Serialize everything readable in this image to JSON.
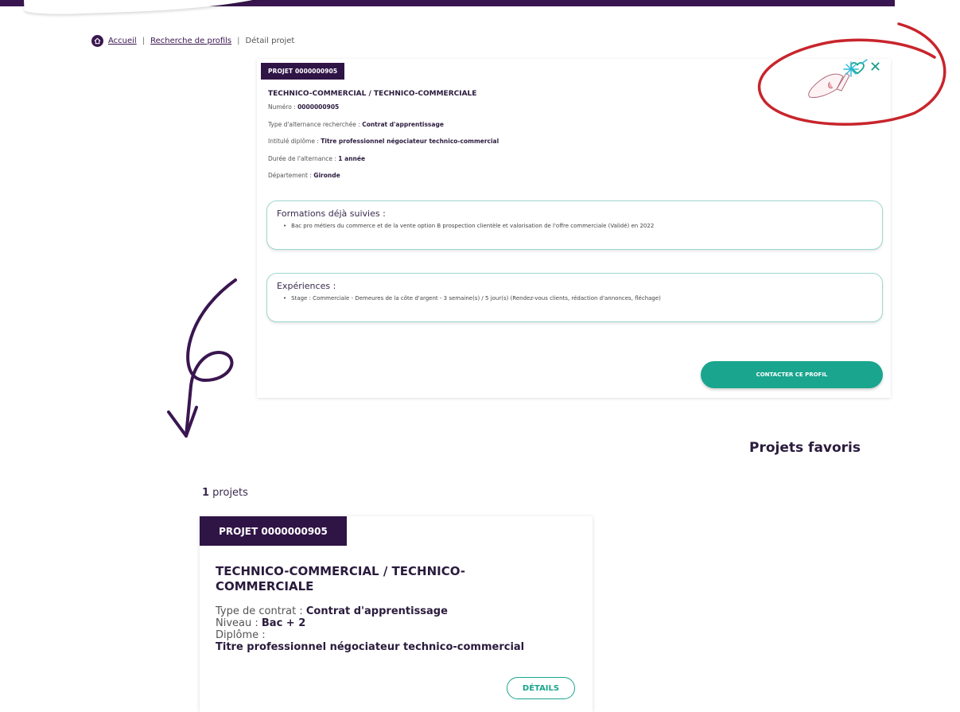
{
  "breadcrumb": {
    "home": "Accueil",
    "search": "Recherche de profils",
    "current": "Détail projet",
    "separator": "|"
  },
  "detail": {
    "tag": "PROJET 0000000905",
    "title": "TECHNICO-COMMERCIAL / TECHNICO-COMMERCIALE",
    "numero_label": "Numéro : ",
    "numero_value": "0000000905",
    "type_label": "Type d'alternance recherchée : ",
    "type_value": "Contrat d'apprentissage",
    "diplome_label": "Intitulé diplôme : ",
    "diplome_value": "Titre professionnel négociateur technico-commercial",
    "duree_label": "Durée de l'alternance : ",
    "duree_value": "1 année",
    "departement_label": "Département : ",
    "departement_value": "Gironde",
    "formations_title": "Formations déjà suivies :",
    "formations_items": [
      "Bac pro métiers du commerce et de la vente option B prospection clientèle et valorisation de l'offre commerciale (Validé) en 2022"
    ],
    "experiences_title": "Expériences :",
    "experiences_items": [
      "Stage : Commerciale - Demeures de la côte d'argent - 3 semaine(s) / 5 jour(s) (Rendez-vous clients, rédaction d'annonces, fléchage)"
    ],
    "contact_button": "CONTACTER CE PROFIL",
    "close_symbol": "✕"
  },
  "favorites": {
    "heading": "Projets favoris",
    "count_number": "1",
    "count_label": " projets",
    "card": {
      "tag": "PROJET 0000000905",
      "title": "TECHNICO-COMMERCIAL / TECHNICO-COMMERCIALE",
      "contrat_label": "Type de contrat : ",
      "contrat_value": "Contrat d'apprentissage",
      "niveau_label": "Niveau : ",
      "niveau_value": "Bac + 2",
      "diplome_label": "Diplôme :",
      "diplome_value": "Titre professionnel négociateur technico-commercial",
      "details_button": "DÉTAILS"
    }
  },
  "colors": {
    "brand_purple": "#2f1446",
    "accent_teal": "#1aa58e",
    "annotation_red": "#c8252c",
    "annotation_purple": "#3a1650"
  },
  "icons": [
    "home-icon",
    "heart-icon",
    "close-icon",
    "hand-pointer-icon",
    "sparkle-icon",
    "arrow-annotation-icon"
  ]
}
